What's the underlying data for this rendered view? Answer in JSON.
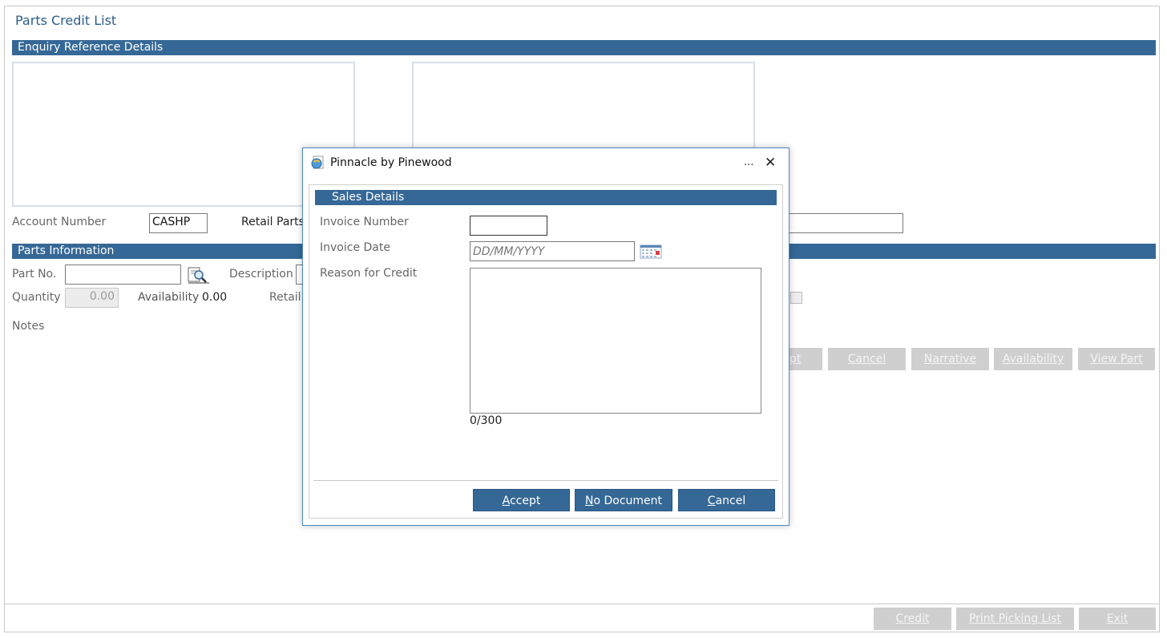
{
  "page": {
    "title": "Parts Credit List",
    "enquiry_section": "Enquiry Reference Details",
    "account_number_label": "Account Number",
    "account_number_value": "CASHP",
    "retail_parts_label": "Retail Parts",
    "parts_section": "Parts Information",
    "part_no_label": "Part No.",
    "description_label": "Description",
    "quantity_label": "Quantity",
    "quantity_value": "0.00",
    "availability_label": "Availability",
    "availability_value": "0.00",
    "retail_label": "Retail",
    "notes_label": "Notes",
    "action_buttons": {
      "accept_partial": "pt",
      "cancel": "Cancel",
      "narrative": "Narrative",
      "availability": "Availability",
      "view_part": "View Part"
    },
    "footer_buttons": {
      "credit": "Credit",
      "print_picking_list": "Print Picking List",
      "exit": "Exit"
    }
  },
  "dialog": {
    "title": "Pinnacle by Pinewood",
    "more_glyph": "...",
    "close_glyph": "✕",
    "section": "Sales Details",
    "invoice_number_label": "Invoice Number",
    "invoice_number_value": "",
    "invoice_date_label": "Invoice Date",
    "invoice_date_placeholder": "DD/MM/YYYY",
    "reason_label": "Reason for Credit",
    "reason_value": "",
    "char_count": "0/300",
    "buttons": {
      "accept_first": "A",
      "accept_rest": "ccept",
      "no_doc_first": "N",
      "no_doc_rest": "o Document",
      "cancel_first": "C",
      "cancel_rest": "ancel"
    }
  },
  "colors": {
    "band": "#356896",
    "title": "#2c5d8a",
    "disabled_button": "#cfcfcf",
    "dialog_border": "#4d89c4"
  },
  "icons": [
    "search-icon",
    "calendar-icon",
    "app-icon",
    "close-icon"
  ]
}
